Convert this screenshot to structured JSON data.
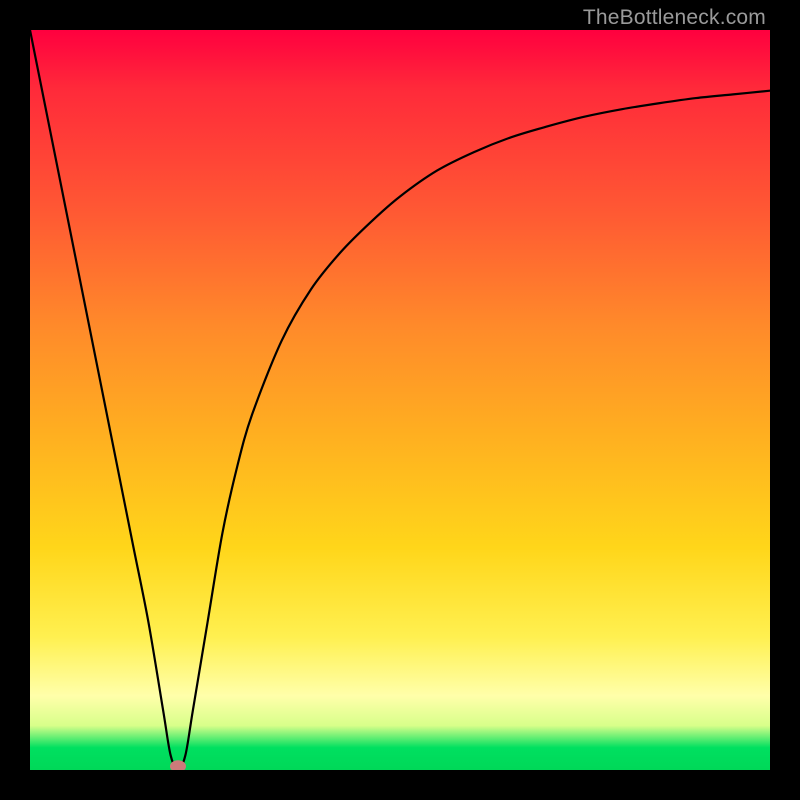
{
  "chart_data": {
    "type": "line",
    "title": "",
    "xlabel": "",
    "ylabel": "",
    "xlim": [
      0,
      100
    ],
    "ylim": [
      0,
      100
    ],
    "grid": false,
    "legend": false,
    "series": [
      {
        "name": "bottleneck-curve",
        "x": [
          0,
          2,
          4,
          6,
          8,
          10,
          12,
          14,
          16,
          18,
          19,
          20,
          21,
          22,
          24,
          26,
          28,
          30,
          34,
          38,
          42,
          46,
          50,
          55,
          60,
          65,
          70,
          75,
          80,
          85,
          90,
          95,
          100
        ],
        "y": [
          100,
          90,
          80,
          70,
          60,
          50,
          40,
          30,
          20,
          8,
          2,
          0,
          2,
          8,
          20,
          32,
          41,
          48,
          58,
          65,
          70,
          74,
          77.5,
          81,
          83.5,
          85.5,
          87,
          88.3,
          89.3,
          90.1,
          90.8,
          91.3,
          91.8
        ]
      }
    ],
    "marker": {
      "x": 20,
      "y": 0.5,
      "label": "optimal-point"
    },
    "background_gradient": {
      "direction": "vertical",
      "stops": [
        {
          "pos": 0.0,
          "color": "#ff003f"
        },
        {
          "pos": 0.4,
          "color": "#ff8a2a"
        },
        {
          "pos": 0.7,
          "color": "#ffd61a"
        },
        {
          "pos": 0.9,
          "color": "#ffffaa"
        },
        {
          "pos": 0.97,
          "color": "#00e060"
        },
        {
          "pos": 1.0,
          "color": "#00d858"
        }
      ]
    }
  },
  "watermark": {
    "text": "TheBottleneck.com"
  }
}
